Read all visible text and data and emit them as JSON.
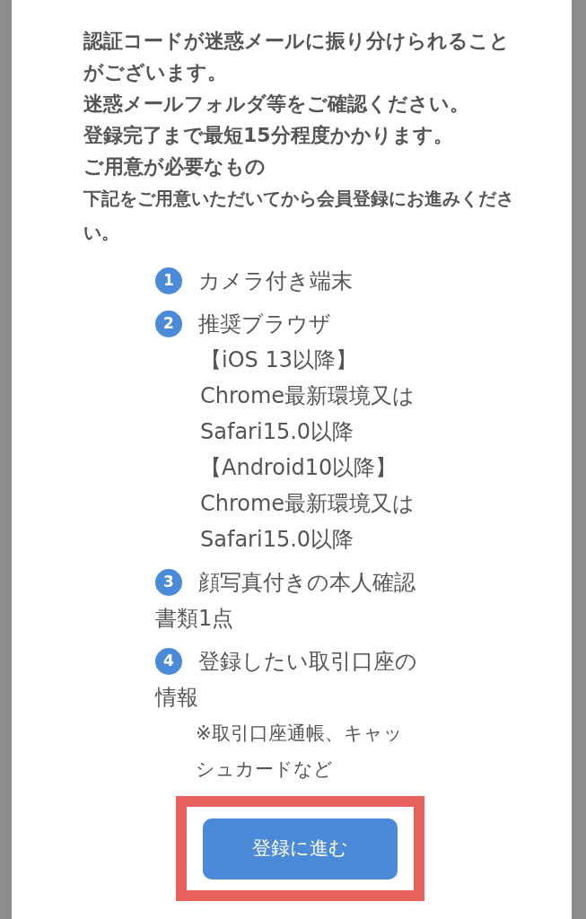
{
  "notice": [
    "認証コードが迷惑メールに振り分けられることがございます。",
    "迷惑メールフォルダ等をご確認ください。",
    "登録完了まで最短15分程度かかります。"
  ],
  "requirements_heading": "ご用意が必要なもの",
  "requirements_intro": "下記をご用意いただいてから会員登録にお進みください。",
  "requirements": [
    {
      "number": "1",
      "text": "カメラ付き端末"
    },
    {
      "number": "2",
      "text": "推奨ブラウザ",
      "details": [
        "【iOS 13以降】",
        "Chrome最新環境又は",
        "Safari15.0以降",
        "【Android10以降】",
        "Chrome最新環境又は",
        "Safari15.0以降"
      ]
    },
    {
      "number": "3",
      "text": "顔写真付きの本人確認",
      "continuation": "書類1点"
    },
    {
      "number": "4",
      "text": "登録したい取引口座の",
      "continuation": "情報",
      "note": "※取引口座通帳、キャッシュカードなど"
    }
  ],
  "button": {
    "label": "登録に進む",
    "highlighted": true
  }
}
